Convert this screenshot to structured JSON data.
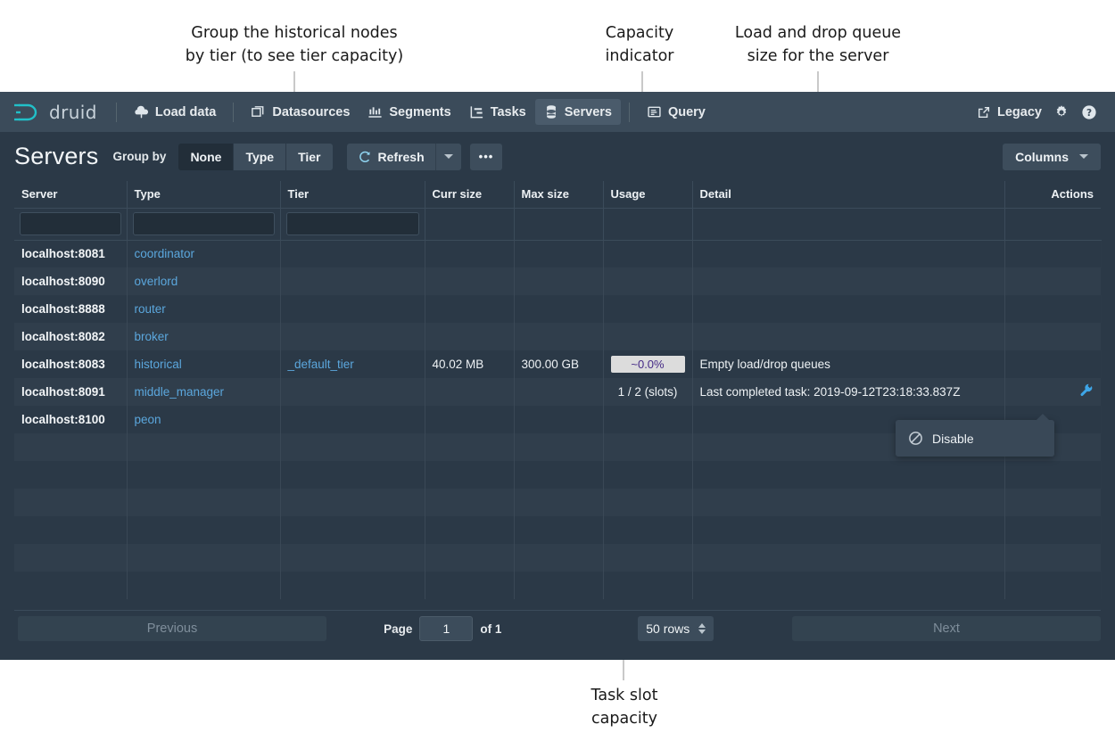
{
  "annotations": [
    {
      "id": "group-by-tier",
      "text": "Group the historical nodes\nby tier (to see tier capacity)"
    },
    {
      "id": "capacity-indicator",
      "text": "Capacity\nindicator"
    },
    {
      "id": "load-drop-queue",
      "text": "Load and drop queue\nsize for the server"
    },
    {
      "id": "task-slot-capacity",
      "text": "Task slot\ncapacity"
    }
  ],
  "navbar": {
    "logo_text": "druid",
    "items": [
      {
        "label": "Load data",
        "icon": "cloud-upload-icon",
        "active": false
      },
      {
        "label": "Datasources",
        "icon": "stacked-layers-icon",
        "active": false
      },
      {
        "label": "Segments",
        "icon": "bar-chart-icon",
        "active": false
      },
      {
        "label": "Tasks",
        "icon": "gantt-chart-icon",
        "active": false
      },
      {
        "label": "Servers",
        "icon": "database-icon",
        "active": true
      },
      {
        "label": "Query",
        "icon": "console-icon",
        "active": false
      }
    ],
    "right": {
      "legacy_label": "Legacy",
      "legacy_icon": "share-external-icon",
      "settings_icon": "gear-icon",
      "help_icon": "help-circle-icon"
    }
  },
  "toolbar": {
    "title": "Servers",
    "group_by_label": "Group by",
    "group_by_options": [
      "None",
      "Type",
      "Tier"
    ],
    "group_by_selected": "None",
    "refresh_label": "Refresh",
    "refresh_icon": "refresh-icon",
    "refresh_dropdown_icon": "chevron-down-icon",
    "more_label": "•••",
    "columns_label": "Columns",
    "columns_icon": "chevron-down-icon"
  },
  "table": {
    "columns": [
      {
        "key": "server",
        "label": "Server",
        "filterable": true,
        "filter_value": "",
        "align": "left"
      },
      {
        "key": "type",
        "label": "Type",
        "filterable": true,
        "filter_value": "",
        "align": "left"
      },
      {
        "key": "tier",
        "label": "Tier",
        "filterable": true,
        "filter_value": "",
        "align": "left"
      },
      {
        "key": "curr_size",
        "label": "Curr size",
        "filterable": false,
        "filter_value": "",
        "align": "left"
      },
      {
        "key": "max_size",
        "label": "Max size",
        "filterable": false,
        "filter_value": "",
        "align": "left"
      },
      {
        "key": "usage",
        "label": "Usage",
        "filterable": false,
        "filter_value": "",
        "align": "left"
      },
      {
        "key": "detail",
        "label": "Detail",
        "filterable": false,
        "filter_value": "",
        "align": "left"
      },
      {
        "key": "actions",
        "label": "Actions",
        "filterable": false,
        "filter_value": "",
        "align": "right"
      }
    ],
    "rows": [
      {
        "server": "localhost:8081",
        "type": "coordinator",
        "tier": "",
        "curr_size": "",
        "max_size": "",
        "usage": "",
        "detail": "",
        "actions": ""
      },
      {
        "server": "localhost:8090",
        "type": "overlord",
        "tier": "",
        "curr_size": "",
        "max_size": "",
        "usage": "",
        "detail": "",
        "actions": ""
      },
      {
        "server": "localhost:8888",
        "type": "router",
        "tier": "",
        "curr_size": "",
        "max_size": "",
        "usage": "",
        "detail": "",
        "actions": ""
      },
      {
        "server": "localhost:8082",
        "type": "broker",
        "tier": "",
        "curr_size": "",
        "max_size": "",
        "usage": "",
        "detail": "",
        "actions": ""
      },
      {
        "server": "localhost:8083",
        "type": "historical",
        "tier": "_default_tier",
        "curr_size": "40.02 MB",
        "max_size": "300.00 GB",
        "usage": "~0.0%",
        "detail": "Empty load/drop queues",
        "actions": ""
      },
      {
        "server": "localhost:8091",
        "type": "middle_manager",
        "tier": "",
        "curr_size": "",
        "max_size": "",
        "usage": "1 / 2 (slots)",
        "detail": "Last completed task: 2019-09-12T23:18:33.837Z",
        "actions": "wrench-icon"
      },
      {
        "server": "localhost:8100",
        "type": "peon",
        "tier": "",
        "curr_size": "",
        "max_size": "",
        "usage": "",
        "detail": "",
        "actions": ""
      }
    ],
    "empty_row_count": 6
  },
  "popover": {
    "items": [
      {
        "label": "Disable",
        "icon": "disable-circle-slash-icon"
      }
    ]
  },
  "pagination": {
    "previous_label": "Previous",
    "next_label": "Next",
    "page_label": "Page",
    "page_value": "1",
    "of_label": "of 1",
    "rows_per_page": "50 rows"
  },
  "colors": {
    "app_bg": "#2b3947",
    "navbar_bg": "#3b4b5a",
    "row_alt_bg": "#303e4c",
    "link": "#5ba7dd",
    "accent": "#3ea6e8",
    "logo_accent": "#21c0c8",
    "usage_pill_bg": "#dcdcdc",
    "usage_pill_text": "#452a86",
    "leader": "#c9c9c9"
  }
}
